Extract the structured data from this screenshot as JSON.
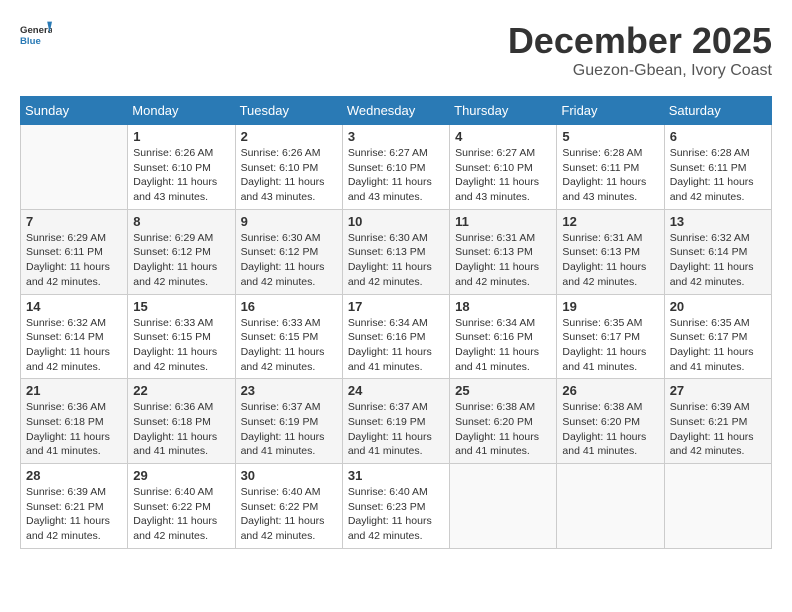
{
  "logo": {
    "text_general": "General",
    "text_blue": "Blue"
  },
  "header": {
    "month": "December 2025",
    "location": "Guezon-Gbean, Ivory Coast"
  },
  "weekdays": [
    "Sunday",
    "Monday",
    "Tuesday",
    "Wednesday",
    "Thursday",
    "Friday",
    "Saturday"
  ],
  "weeks": [
    [
      {
        "day": "",
        "sunrise": "",
        "sunset": "",
        "daylight": ""
      },
      {
        "day": "1",
        "sunrise": "Sunrise: 6:26 AM",
        "sunset": "Sunset: 6:10 PM",
        "daylight": "Daylight: 11 hours and 43 minutes."
      },
      {
        "day": "2",
        "sunrise": "Sunrise: 6:26 AM",
        "sunset": "Sunset: 6:10 PM",
        "daylight": "Daylight: 11 hours and 43 minutes."
      },
      {
        "day": "3",
        "sunrise": "Sunrise: 6:27 AM",
        "sunset": "Sunset: 6:10 PM",
        "daylight": "Daylight: 11 hours and 43 minutes."
      },
      {
        "day": "4",
        "sunrise": "Sunrise: 6:27 AM",
        "sunset": "Sunset: 6:10 PM",
        "daylight": "Daylight: 11 hours and 43 minutes."
      },
      {
        "day": "5",
        "sunrise": "Sunrise: 6:28 AM",
        "sunset": "Sunset: 6:11 PM",
        "daylight": "Daylight: 11 hours and 43 minutes."
      },
      {
        "day": "6",
        "sunrise": "Sunrise: 6:28 AM",
        "sunset": "Sunset: 6:11 PM",
        "daylight": "Daylight: 11 hours and 42 minutes."
      }
    ],
    [
      {
        "day": "7",
        "sunrise": "Sunrise: 6:29 AM",
        "sunset": "Sunset: 6:11 PM",
        "daylight": "Daylight: 11 hours and 42 minutes."
      },
      {
        "day": "8",
        "sunrise": "Sunrise: 6:29 AM",
        "sunset": "Sunset: 6:12 PM",
        "daylight": "Daylight: 11 hours and 42 minutes."
      },
      {
        "day": "9",
        "sunrise": "Sunrise: 6:30 AM",
        "sunset": "Sunset: 6:12 PM",
        "daylight": "Daylight: 11 hours and 42 minutes."
      },
      {
        "day": "10",
        "sunrise": "Sunrise: 6:30 AM",
        "sunset": "Sunset: 6:13 PM",
        "daylight": "Daylight: 11 hours and 42 minutes."
      },
      {
        "day": "11",
        "sunrise": "Sunrise: 6:31 AM",
        "sunset": "Sunset: 6:13 PM",
        "daylight": "Daylight: 11 hours and 42 minutes."
      },
      {
        "day": "12",
        "sunrise": "Sunrise: 6:31 AM",
        "sunset": "Sunset: 6:13 PM",
        "daylight": "Daylight: 11 hours and 42 minutes."
      },
      {
        "day": "13",
        "sunrise": "Sunrise: 6:32 AM",
        "sunset": "Sunset: 6:14 PM",
        "daylight": "Daylight: 11 hours and 42 minutes."
      }
    ],
    [
      {
        "day": "14",
        "sunrise": "Sunrise: 6:32 AM",
        "sunset": "Sunset: 6:14 PM",
        "daylight": "Daylight: 11 hours and 42 minutes."
      },
      {
        "day": "15",
        "sunrise": "Sunrise: 6:33 AM",
        "sunset": "Sunset: 6:15 PM",
        "daylight": "Daylight: 11 hours and 42 minutes."
      },
      {
        "day": "16",
        "sunrise": "Sunrise: 6:33 AM",
        "sunset": "Sunset: 6:15 PM",
        "daylight": "Daylight: 11 hours and 42 minutes."
      },
      {
        "day": "17",
        "sunrise": "Sunrise: 6:34 AM",
        "sunset": "Sunset: 6:16 PM",
        "daylight": "Daylight: 11 hours and 41 minutes."
      },
      {
        "day": "18",
        "sunrise": "Sunrise: 6:34 AM",
        "sunset": "Sunset: 6:16 PM",
        "daylight": "Daylight: 11 hours and 41 minutes."
      },
      {
        "day": "19",
        "sunrise": "Sunrise: 6:35 AM",
        "sunset": "Sunset: 6:17 PM",
        "daylight": "Daylight: 11 hours and 41 minutes."
      },
      {
        "day": "20",
        "sunrise": "Sunrise: 6:35 AM",
        "sunset": "Sunset: 6:17 PM",
        "daylight": "Daylight: 11 hours and 41 minutes."
      }
    ],
    [
      {
        "day": "21",
        "sunrise": "Sunrise: 6:36 AM",
        "sunset": "Sunset: 6:18 PM",
        "daylight": "Daylight: 11 hours and 41 minutes."
      },
      {
        "day": "22",
        "sunrise": "Sunrise: 6:36 AM",
        "sunset": "Sunset: 6:18 PM",
        "daylight": "Daylight: 11 hours and 41 minutes."
      },
      {
        "day": "23",
        "sunrise": "Sunrise: 6:37 AM",
        "sunset": "Sunset: 6:19 PM",
        "daylight": "Daylight: 11 hours and 41 minutes."
      },
      {
        "day": "24",
        "sunrise": "Sunrise: 6:37 AM",
        "sunset": "Sunset: 6:19 PM",
        "daylight": "Daylight: 11 hours and 41 minutes."
      },
      {
        "day": "25",
        "sunrise": "Sunrise: 6:38 AM",
        "sunset": "Sunset: 6:20 PM",
        "daylight": "Daylight: 11 hours and 41 minutes."
      },
      {
        "day": "26",
        "sunrise": "Sunrise: 6:38 AM",
        "sunset": "Sunset: 6:20 PM",
        "daylight": "Daylight: 11 hours and 41 minutes."
      },
      {
        "day": "27",
        "sunrise": "Sunrise: 6:39 AM",
        "sunset": "Sunset: 6:21 PM",
        "daylight": "Daylight: 11 hours and 42 minutes."
      }
    ],
    [
      {
        "day": "28",
        "sunrise": "Sunrise: 6:39 AM",
        "sunset": "Sunset: 6:21 PM",
        "daylight": "Daylight: 11 hours and 42 minutes."
      },
      {
        "day": "29",
        "sunrise": "Sunrise: 6:40 AM",
        "sunset": "Sunset: 6:22 PM",
        "daylight": "Daylight: 11 hours and 42 minutes."
      },
      {
        "day": "30",
        "sunrise": "Sunrise: 6:40 AM",
        "sunset": "Sunset: 6:22 PM",
        "daylight": "Daylight: 11 hours and 42 minutes."
      },
      {
        "day": "31",
        "sunrise": "Sunrise: 6:40 AM",
        "sunset": "Sunset: 6:23 PM",
        "daylight": "Daylight: 11 hours and 42 minutes."
      },
      {
        "day": "",
        "sunrise": "",
        "sunset": "",
        "daylight": ""
      },
      {
        "day": "",
        "sunrise": "",
        "sunset": "",
        "daylight": ""
      },
      {
        "day": "",
        "sunrise": "",
        "sunset": "",
        "daylight": ""
      }
    ]
  ]
}
